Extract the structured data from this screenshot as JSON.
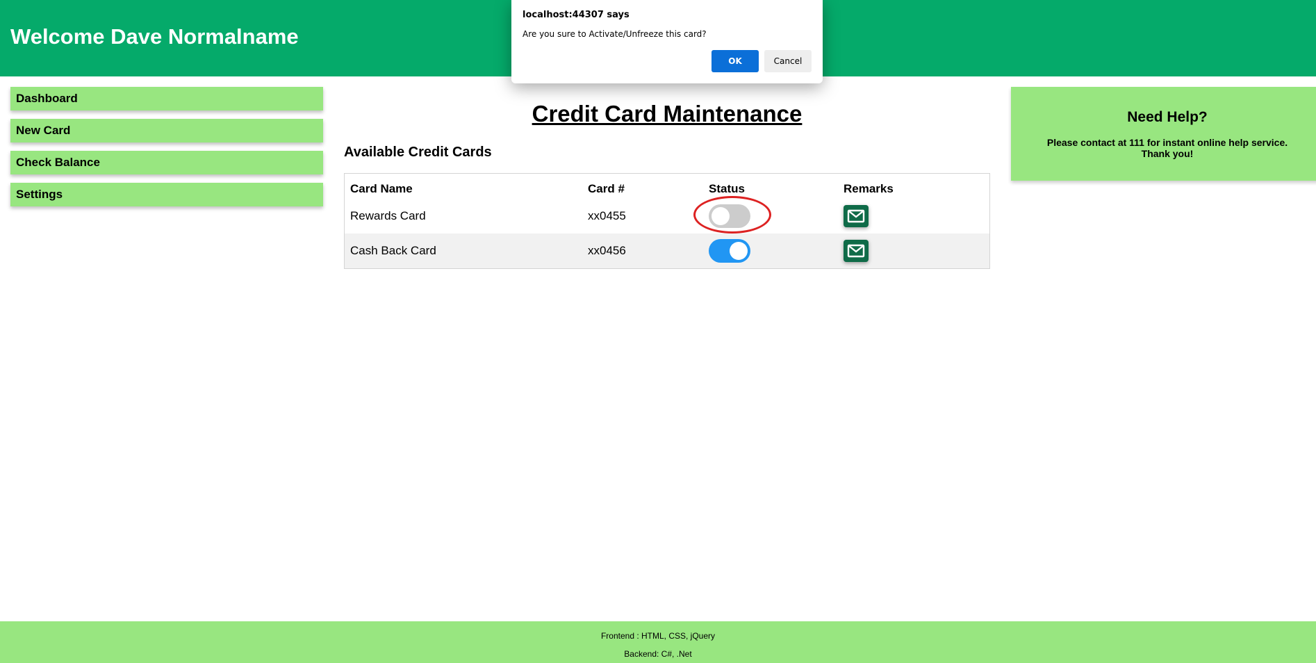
{
  "header": {
    "title": "Welcome Dave Normalname"
  },
  "sidebar": {
    "items": [
      {
        "label": "Dashboard"
      },
      {
        "label": "New Card"
      },
      {
        "label": "Check Balance"
      },
      {
        "label": "Settings"
      }
    ]
  },
  "main": {
    "title": "Credit Card Maintenance",
    "section_title": "Available Credit Cards",
    "table": {
      "columns": [
        "Card Name",
        "Card #",
        "Status",
        "Remarks"
      ],
      "rows": [
        {
          "name": "Rewards Card",
          "number": "xx0455",
          "status_active": false,
          "remarks_icon": "envelope-icon"
        },
        {
          "name": "Cash Back Card",
          "number": "xx0456",
          "status_active": true,
          "remarks_icon": "envelope-icon"
        }
      ]
    }
  },
  "help": {
    "title": "Need Help?",
    "text": "Please contact at 111 for instant online help service. Thank you!"
  },
  "footer": {
    "frontend": "Frontend : HTML, CSS, jQuery",
    "backend": "Backend: C#, .Net"
  },
  "dialog": {
    "origin": "localhost:44307 says",
    "message": "Are you sure to Activate/Unfreeze this card?",
    "ok_label": "OK",
    "cancel_label": "Cancel"
  },
  "colors": {
    "header_bg": "#05aa6a",
    "panel_bg": "#98e680",
    "toggle_on": "#2196f3",
    "toggle_off": "#cccccc",
    "remarks_button": "#0f6b48",
    "annotation": "#dd2222",
    "dialog_ok": "#0b6fd8"
  }
}
